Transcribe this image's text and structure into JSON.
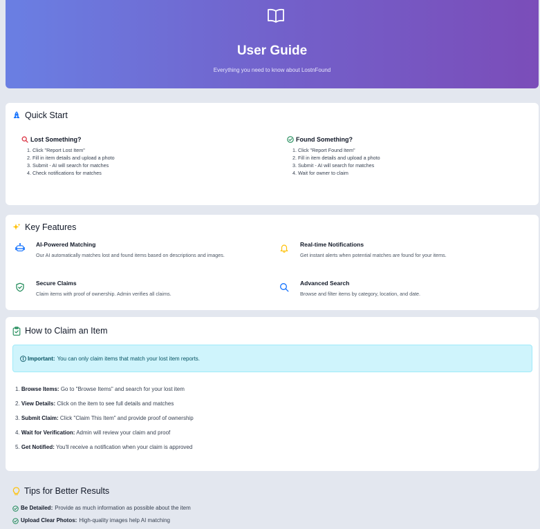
{
  "header": {
    "title": "User Guide",
    "subtitle": "Everything you need to know about LostnFound",
    "icon": "book-icon"
  },
  "quick_start": {
    "title": "Quick Start",
    "icon": "rocket-icon",
    "lost": {
      "title": "Lost Something?",
      "icon": "search-icon",
      "steps": [
        "1. Click \"Report Lost Item\"",
        "2. Fill in item details and upload a photo",
        "3. Submit - AI will search for matches",
        "4. Check notifications for matches"
      ]
    },
    "found": {
      "title": "Found Something?",
      "icon": "check-circle-icon",
      "steps": [
        "1. Click \"Report Found Item\"",
        "2. Fill in item details and upload a photo",
        "3. Submit - AI will search for matches",
        "4. Wait for owner to claim"
      ]
    }
  },
  "features": {
    "title": "Key Features",
    "icon": "sparkles-icon",
    "items": [
      {
        "title": "AI-Powered Matching",
        "desc": "Our AI automatically matches lost and found items based on descriptions and images.",
        "icon": "robot-icon"
      },
      {
        "title": "Real-time Notifications",
        "desc": "Get instant alerts when potential matches are found for your items.",
        "icon": "bell-icon"
      },
      {
        "title": "Secure Claims",
        "desc": "Claim items with proof of ownership. Admin verifies all claims.",
        "icon": "shield-check-icon"
      },
      {
        "title": "Advanced Search",
        "desc": "Browse and filter items by category, location, and date.",
        "icon": "search-icon"
      }
    ]
  },
  "claim": {
    "title": "How to Claim an Item",
    "icon": "clipboard-check-icon",
    "alert": {
      "label": "Important:",
      "text": "You can only claim items that match your lost item reports.",
      "icon": "info-icon"
    },
    "steps": [
      {
        "num": "1.",
        "label": "Browse Items:",
        "text": "Go to \"Browse Items\" and search for your lost item"
      },
      {
        "num": "2.",
        "label": "View Details:",
        "text": "Click on the item to see full details and matches"
      },
      {
        "num": "3.",
        "label": "Submit Claim:",
        "text": "Click \"Claim This Item\" and provide proof of ownership"
      },
      {
        "num": "4.",
        "label": "Wait for Verification:",
        "text": "Admin will review your claim and proof"
      },
      {
        "num": "5.",
        "label": "Get Notified:",
        "text": "You'll receive a notification when your claim is approved"
      }
    ]
  },
  "tips": {
    "title": "Tips for Better Results",
    "icon": "lightbulb-icon",
    "items": [
      {
        "label": "Be Detailed:",
        "text": "Provide as much information as possible about the item"
      },
      {
        "label": "Upload Clear Photos:",
        "text": "High-quality images help AI matching"
      }
    ]
  },
  "colors": {
    "header_gradient_start": "#6a7fe3",
    "header_gradient_end": "#7b4db9",
    "page_bg": "#e3e7ef",
    "alert_bg": "#cff4fc",
    "lost_icon": "#dc3545",
    "success_icon": "#198754",
    "feature_icon": "#0d6efd",
    "warning_icon": "#ffc107"
  }
}
